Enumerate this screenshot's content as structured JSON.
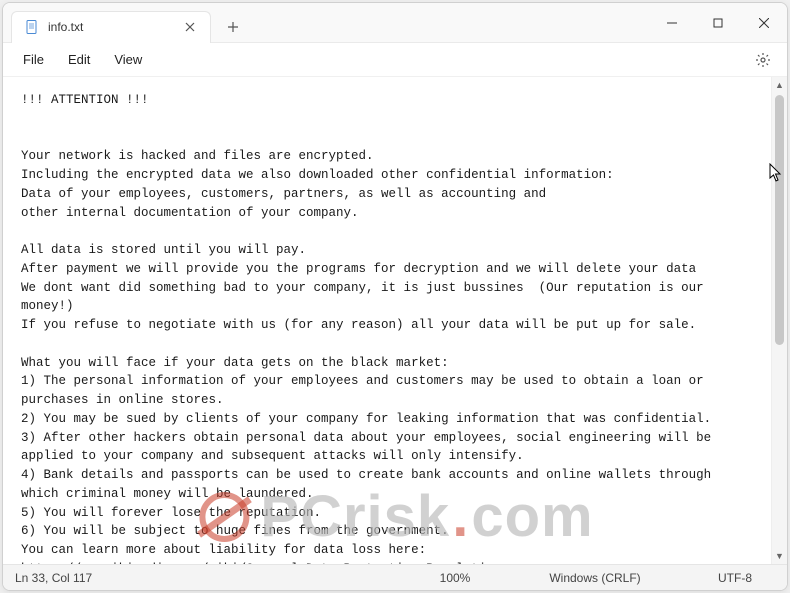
{
  "tab": {
    "title": "info.txt"
  },
  "menubar": {
    "file": "File",
    "edit": "Edit",
    "view": "View"
  },
  "document": {
    "text": "!!! ATTENTION !!!\n\n\nYour network is hacked and files are encrypted.\nIncluding the encrypted data we also downloaded other confidential information:\nData of your employees, customers, partners, as well as accounting and\nother internal documentation of your company.\n\nAll data is stored until you will pay.\nAfter payment we will provide you the programs for decryption and we will delete your data\nWe dont want did something bad to your company, it is just bussines  (Our reputation is our money!)\nIf you refuse to negotiate with us (for any reason) all your data will be put up for sale.\n\nWhat you will face if your data gets on the black market:\n1) The personal information of your employees and customers may be used to obtain a loan or\npurchases in online stores.\n2) You may be sued by clients of your company for leaking information that was confidential.\n3) After other hackers obtain personal data about your employees, social engineering will be\napplied to your company and subsequent attacks will only intensify.\n4) Bank details and passports can be used to create bank accounts and online wallets through\nwhich criminal money will be laundered.\n5) You will forever lose the reputation.\n6) You will be subject to huge fines from the government.\nYou can learn more about liability for data loss here:\nhttps://en.wikipedia.org/wiki/General_Data_Protection_Regulation\nhttps://gdpr-info.eu/\nCourts, fines and the inability to use important files will lead you to huge losses.\nThe consequences of this will be irreversible for you.\nContacting the police will not save you from these consequences, and lost data,"
  },
  "statusbar": {
    "position": "Ln 33, Col 117",
    "zoom": "100%",
    "line_ending": "Windows (CRLF)",
    "encoding": "UTF-8"
  },
  "watermark": {
    "text_before": "PCrisk",
    "text_after": "com"
  }
}
